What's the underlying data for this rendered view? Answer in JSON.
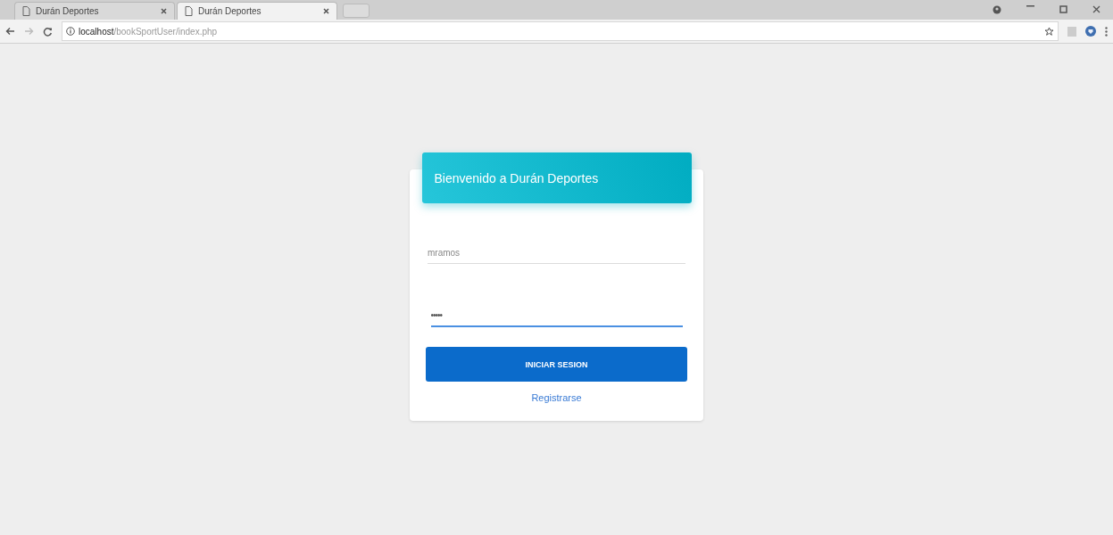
{
  "browser": {
    "tabs": [
      {
        "title": "Durán Deportes",
        "selected": false
      },
      {
        "title": "Durán Deportes",
        "selected": true
      }
    ],
    "address": {
      "host": "localhost",
      "path": "/bookSportUser/index.php"
    }
  },
  "login": {
    "title": "Bienvenido a Durán Deportes",
    "fields": [
      {
        "kind": "text",
        "value": "mramos",
        "focused": false
      },
      {
        "kind": "password",
        "value": "•••••",
        "focused": true
      }
    ],
    "submit": "INICIAR SESION",
    "register_link": "Registrarse"
  }
}
